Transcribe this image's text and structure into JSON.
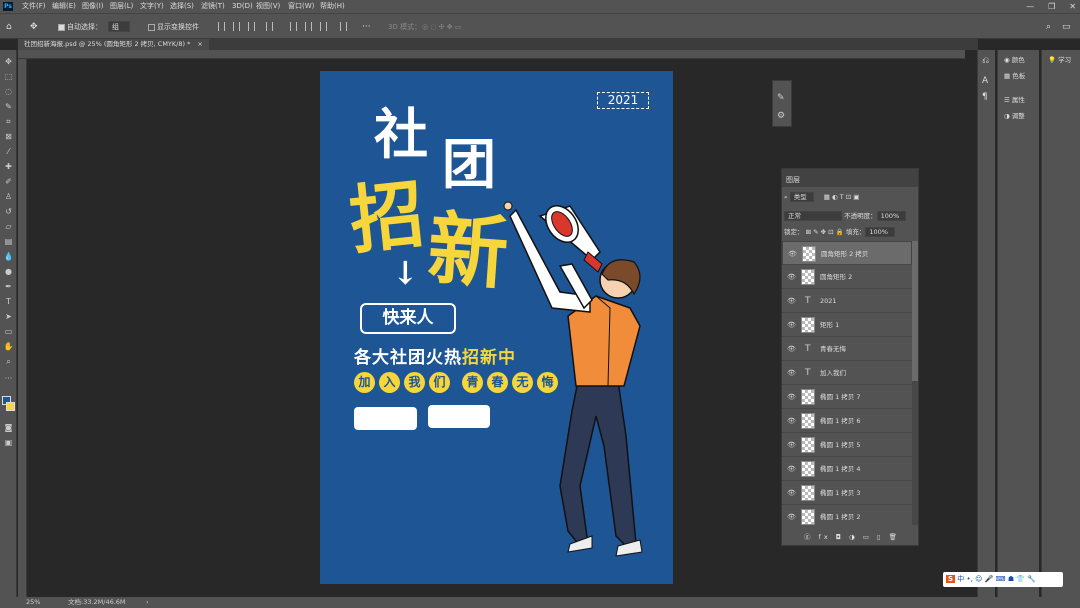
{
  "app": {
    "logo": "Ps"
  },
  "menu": [
    "文件(F)",
    "编辑(E)",
    "图像(I)",
    "图层(L)",
    "文字(Y)",
    "选择(S)",
    "滤镜(T)",
    "3D(D)",
    "视图(V)",
    "窗口(W)",
    "帮助(H)"
  ],
  "window_controls": [
    "—",
    "❐",
    "✕"
  ],
  "options": {
    "auto_select_label": "自动选择：",
    "auto_select_value": "组",
    "show_transform_label": "显示变换控件",
    "more": "···",
    "mode_3d": "3D 模式："
  },
  "document_tab": {
    "title": "社团招新海报.psd @ 25% (圆角矩形 2 拷贝, CMYK/8) *",
    "close": "×"
  },
  "poster": {
    "year": "2021",
    "char1": "社",
    "char2": "团",
    "char3": "招",
    "char4": "新",
    "arrow": "↓",
    "button_text": "快来人",
    "line1_white": "各大社团火热",
    "line1_yellow": "招新中",
    "circles": [
      "加",
      "入",
      "我",
      "们",
      "青",
      "春",
      "无",
      "悔"
    ]
  },
  "layers_panel": {
    "title": "图层",
    "filter": "类型",
    "blend_mode": "正常",
    "opacity_label": "不透明度：",
    "opacity_value": "100%",
    "lock_label": "锁定：",
    "fill_label": "填充：",
    "fill_value": "100%",
    "layers": [
      {
        "name": "圆角矩形 2 拷贝",
        "kind": "shape",
        "selected": true
      },
      {
        "name": "圆角矩形 2",
        "kind": "shape",
        "selected": false
      },
      {
        "name": "2021",
        "kind": "text",
        "selected": false
      },
      {
        "name": "矩形 1",
        "kind": "shape",
        "selected": false
      },
      {
        "name": "青春无悔",
        "kind": "text",
        "selected": false
      },
      {
        "name": "加入我们",
        "kind": "text",
        "selected": false
      },
      {
        "name": "椭圆 1 拷贝 7",
        "kind": "shape",
        "selected": false
      },
      {
        "name": "椭圆 1 拷贝 6",
        "kind": "shape",
        "selected": false
      },
      {
        "name": "椭圆 1 拷贝 5",
        "kind": "shape",
        "selected": false
      },
      {
        "name": "椭圆 1 拷贝 4",
        "kind": "shape",
        "selected": false
      },
      {
        "name": "椭圆 1 拷贝 3",
        "kind": "shape",
        "selected": false
      },
      {
        "name": "椭圆 1 拷贝 2",
        "kind": "shape",
        "selected": false
      }
    ],
    "footer_icons": "ⓖ fx ◘ ◑ ▭ ▯ 🗑"
  },
  "right_panels": {
    "color": "颜色",
    "swatches": "色板",
    "properties": "属性",
    "adjustments": "调整",
    "learn": "学习"
  },
  "status": {
    "zoom": "25%",
    "doc": "文档:33.2M/46.6M"
  },
  "ime": {
    "logo": "S",
    "text": "中 •, ☺ 🎤 ⌨ ☗ 👕 🔧"
  },
  "colors": {
    "poster_bg": "#1e5594",
    "accent_yellow": "#f7d63b",
    "panel": "#535353",
    "canvas_bg": "#282828"
  }
}
